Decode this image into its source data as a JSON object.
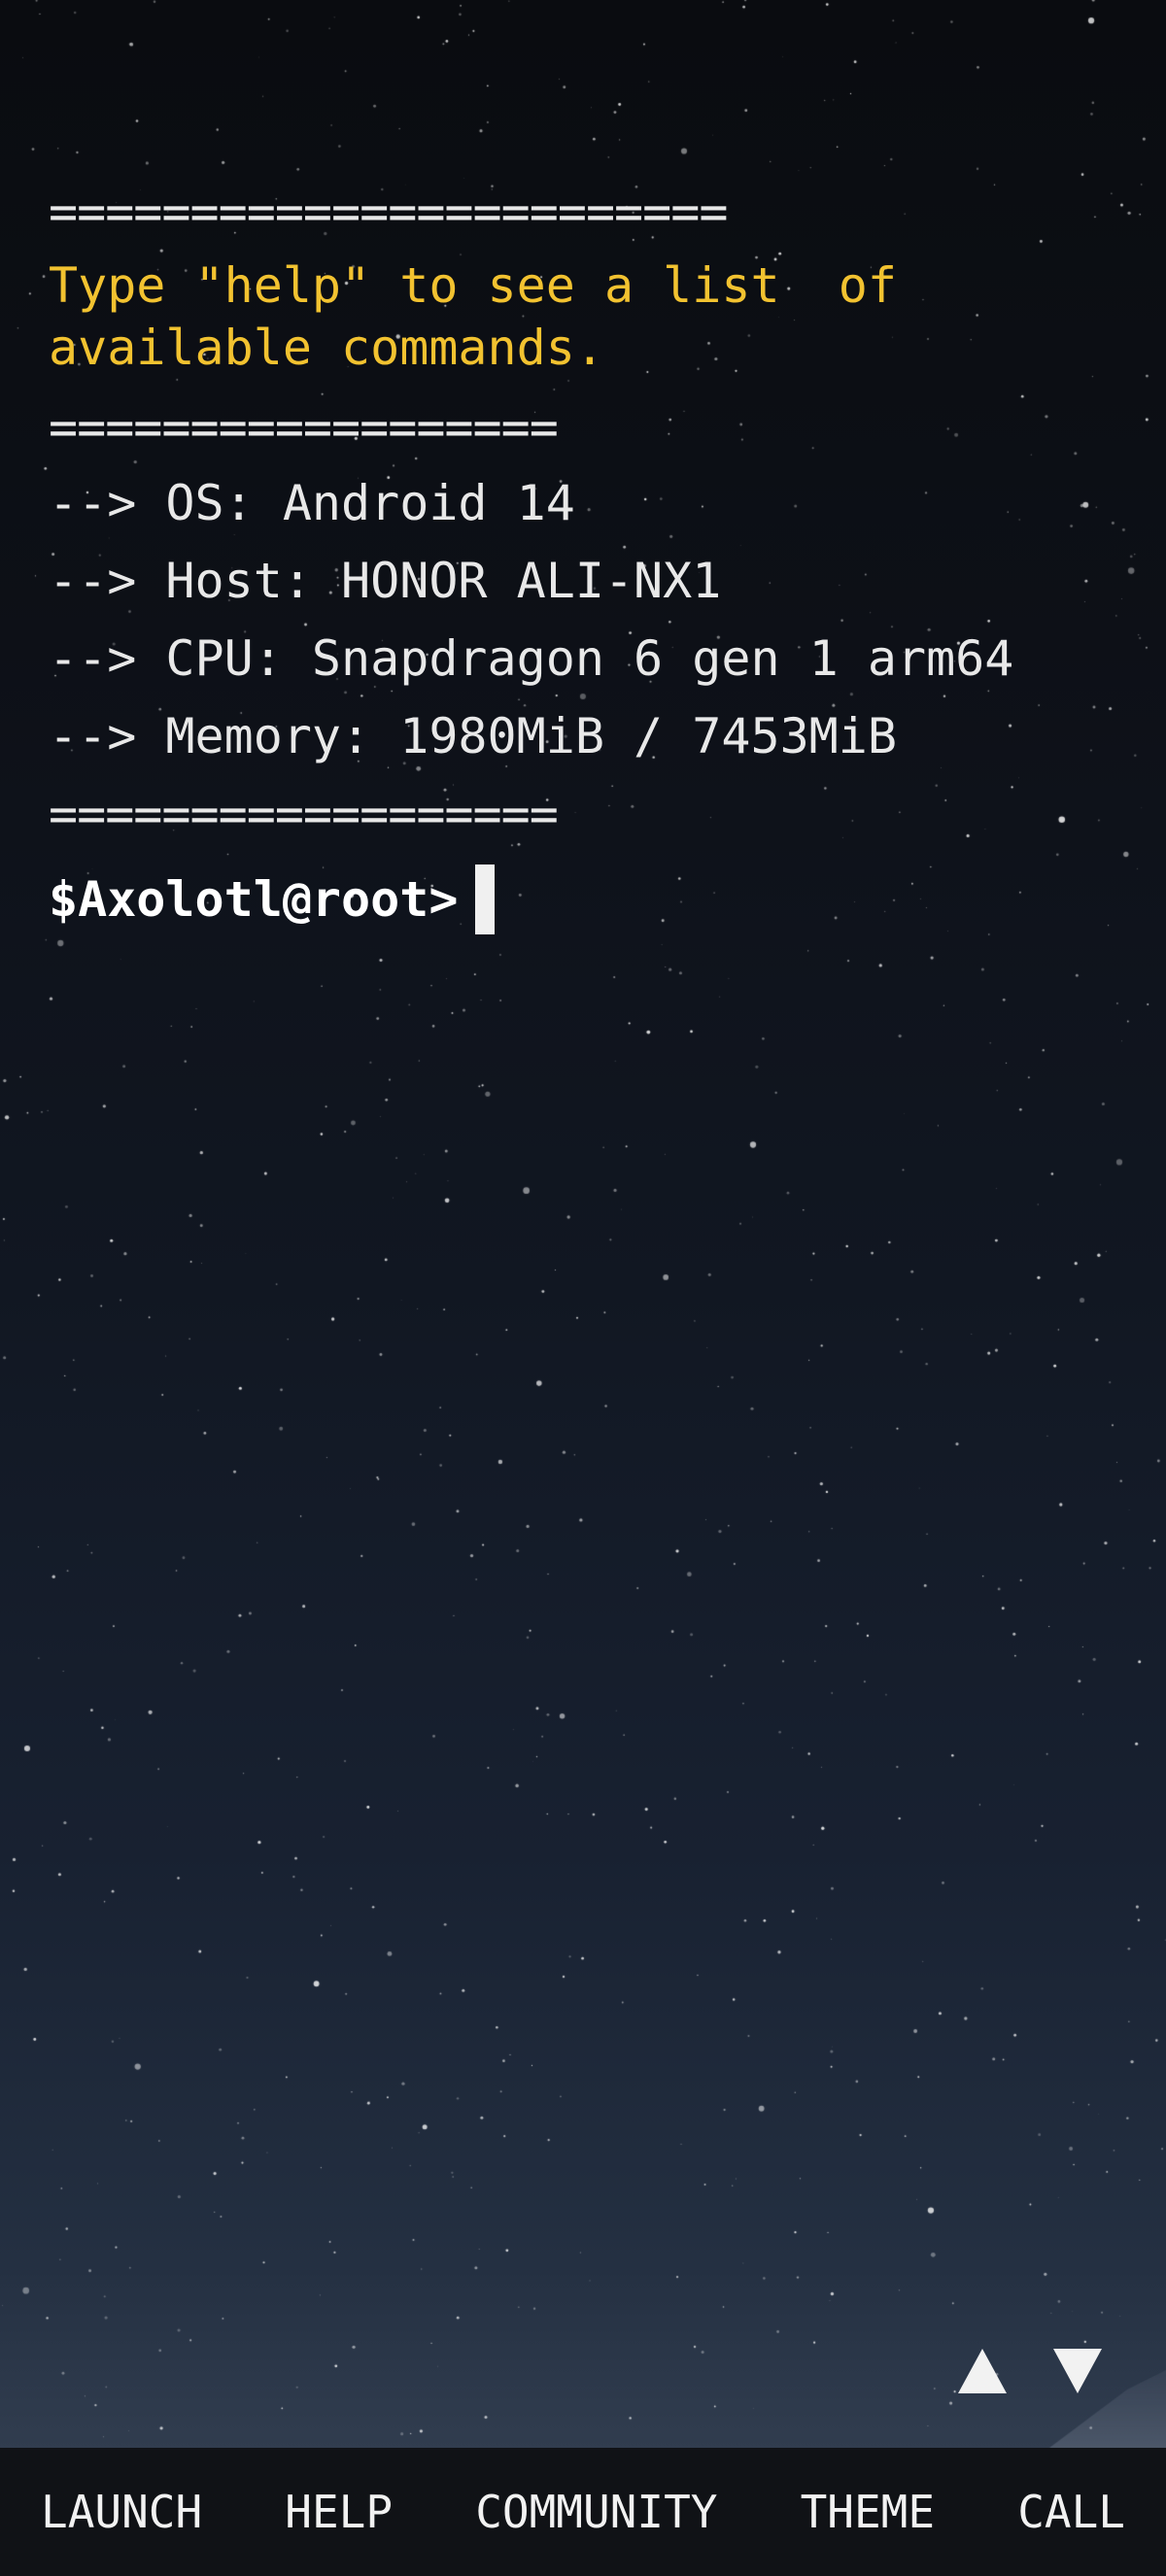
{
  "terminal": {
    "separator_top": "========================",
    "notice": "Type \"help\" to see a list  of available commands.",
    "separator_mid": "==================",
    "info": [
      "--> OS: Android 14",
      "--> Host: HONOR ALI-NX1",
      "--> CPU: Snapdragon 6 gen 1 arm64",
      "--> Memory: 1980MiB / 7453MiB"
    ],
    "separator_bottom": "==================",
    "prompt": "$Axolotl@root>"
  },
  "colors": {
    "text": "#e8e8e8",
    "notice": "#f2c230",
    "background": "#0b0d12",
    "bar": "#101216"
  },
  "icons": {
    "scroll_up": "triangle-up-icon",
    "scroll_down": "triangle-down-icon"
  },
  "bottom_bar": {
    "launch": "LAUNCH",
    "help": "HELP",
    "community": "COMMUNITY",
    "theme": "THEME",
    "call": "CALL"
  }
}
